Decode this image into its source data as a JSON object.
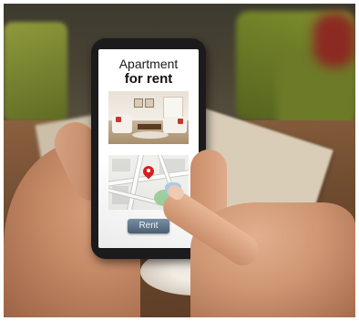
{
  "phone_screen": {
    "title_line1": "Apartment",
    "title_line2": "for rent",
    "photo_icon": "living-room-photo",
    "map_icon": "map-with-location-pin",
    "button_label": "Rent"
  },
  "colors": {
    "pin": "#d61f1f",
    "button": "#5f7489",
    "sofa_cushion": "#c0392b"
  }
}
